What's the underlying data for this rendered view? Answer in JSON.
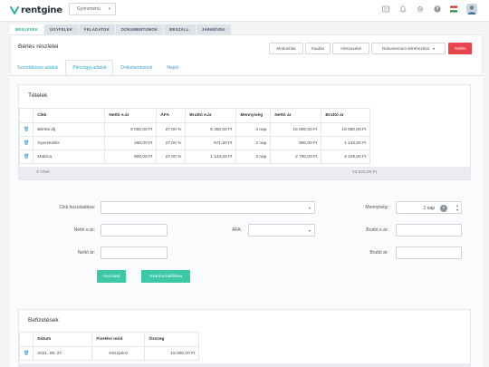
{
  "app": {
    "logo_text": "rentgine"
  },
  "quick_menu": {
    "label": "Gyorsmenü"
  },
  "main_tabs": [
    "BÉRLÉSEK",
    "ÜGYFELEK",
    "FELADATOK",
    "DOKUMENTUMOK",
    "BESZÁLL.",
    "JÁRMŰVEK"
  ],
  "page": {
    "title": "Bérlés részletei",
    "buttons": {
      "edit": "Módosítás",
      "issue": "Kiadás",
      "return": "Visszavétel",
      "create_doc": "Dokumentum létrehozása",
      "delete": "Törlés"
    }
  },
  "sub_tabs": [
    "Szerződéses adatok",
    "Pénzügyi adatok",
    "Dokumentumok",
    "Napló"
  ],
  "items": {
    "title": "Tételek",
    "columns": [
      "",
      "Cikk",
      "Nettó e.ár",
      "ÁFA",
      "Bruttó e.ár",
      "Mennyiség",
      "Nettó ár",
      "Bruttó ár"
    ],
    "rows": [
      [
        "Bérleti díj",
        "5 000,00 Ft",
        "27,00 %",
        "6 350,00 Ft",
        "3 nap",
        "15 000,00 Ft",
        "19 050,00 Ft"
      ],
      [
        "Gyerekülés",
        "450,00 Ft",
        "27,00 %",
        "571,50 Ft",
        "2 nap",
        "900,00 Ft",
        "1 143,00 Ft"
      ],
      [
        "Matrica",
        "900,00 Ft",
        "27,00 %",
        "1 143,00 Ft",
        "3 nap",
        "2 700,00 Ft",
        "3 429,00 Ft"
      ]
    ],
    "summary_count": "3 Tétel",
    "summary_total": "23 622,00 Ft"
  },
  "form": {
    "item_add_label": "Cikk hozzáadása:",
    "quantity_label": "Mennyiség:",
    "quantity_value": "1 nap",
    "net_unit_label": "Nettó e.ár:",
    "vat_label": "ÁFA:",
    "gross_unit_label": "Bruttó e.ár:",
    "net_price_label": "Nettó ár:",
    "gross_price_label": "Bruttó ár:",
    "add_button": "Hozzáad",
    "invoice_button": "Számla kiállítása"
  },
  "payments": {
    "title": "Befizetések",
    "columns": [
      "",
      "Dátum",
      "Fizetési mód",
      "Összeg"
    ],
    "rows": [
      [
        "2021. 09. 27.",
        "Készpénz",
        "15 000,00 Ft"
      ]
    ]
  },
  "colors": {
    "accent": "#2cb3a0",
    "danger": "#e9434b",
    "link": "#3aa6c9",
    "trash": "#3d8fd6"
  }
}
